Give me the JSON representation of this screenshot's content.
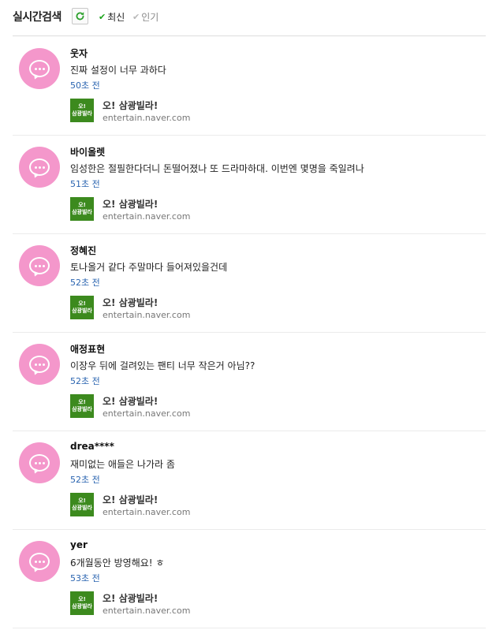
{
  "header": {
    "title": "실시간검색",
    "sort_latest": "최신",
    "sort_popular": "인기"
  },
  "colors": {
    "avatar": "#f497cb",
    "time_link": "#2a64b0",
    "thumb_green": "#3c8a1e",
    "active_check": "#1aa31a"
  },
  "posts": [
    {
      "author": "웃자",
      "text": "진짜 설정이 너무 과하다",
      "time": "50초 전",
      "source_title": "오! 삼광빌라!",
      "source_url": "entertain.naver.com",
      "thumb_line1": "오!",
      "thumb_line2": "삼광빌라"
    },
    {
      "author": "바이올렛",
      "text": "임성한은 절필한다더니 돈떨어졌나 또 드라마하대. 이번엔 몇명을 죽일려나",
      "time": "51초 전",
      "source_title": "오! 삼광빌라!",
      "source_url": "entertain.naver.com",
      "thumb_line1": "오!",
      "thumb_line2": "삼광빌라"
    },
    {
      "author": "정혜진",
      "text": "토나올거 같다 주말마다 들어져있을건데",
      "time": "52초 전",
      "source_title": "오! 삼광빌라!",
      "source_url": "entertain.naver.com",
      "thumb_line1": "오!",
      "thumb_line2": "삼광빌라"
    },
    {
      "author": "애정표현",
      "text": "이장우 뒤에 걸려있는 팬티 너무 작은거 아님??",
      "time": "52초 전",
      "source_title": "오! 삼광빌라!",
      "source_url": "entertain.naver.com",
      "thumb_line1": "오!",
      "thumb_line2": "삼광빌라"
    },
    {
      "author": "drea****",
      "text": "재미없는 애들은 나가라 좀",
      "time": "52초 전",
      "source_title": "오! 삼광빌라!",
      "source_url": "entertain.naver.com",
      "thumb_line1": "오!",
      "thumb_line2": "삼광빌라"
    },
    {
      "author": "yer",
      "text": "6개월동안 방영해요! ㅎ",
      "time": "53초 전",
      "source_title": "오! 삼광빌라!",
      "source_url": "entertain.naver.com",
      "thumb_line1": "오!",
      "thumb_line2": "삼광빌라"
    }
  ]
}
